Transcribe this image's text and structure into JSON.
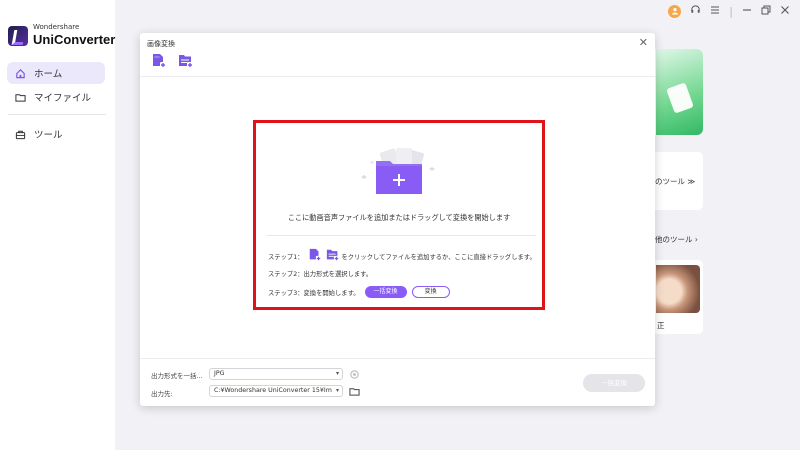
{
  "app": {
    "brand_small": "Wondershare",
    "brand_name": "UniConverter"
  },
  "sidebar": {
    "items": [
      {
        "label": "ホーム",
        "icon": "home-icon"
      },
      {
        "label": "マイファイル",
        "icon": "folder-icon"
      },
      {
        "label": "ツール",
        "icon": "toolbox-icon"
      }
    ]
  },
  "window": {
    "avatar_icon": "user-avatar-icon",
    "support_icon": "headset-icon",
    "menu_icon": "hamburger-menu-icon"
  },
  "background": {
    "tool_card_text": "のツール ≫",
    "more_tools_text": "他のツール ›",
    "photo_caption": "正"
  },
  "dialog": {
    "title": "画像変換",
    "drop_text": "ここに動画音声ファイルを追加またはドラッグして変換を開始します",
    "step1_prefix": "ステップ1：",
    "step1_suffix": "をクリックしてファイルを追加するか、ここに直接ドラッグします。",
    "step2": "ステップ2：出力形式を選択します。",
    "step3": "ステップ3：変換を開始します。",
    "convert_all_pill": "一括変換",
    "convert_pill": "変換",
    "output_format_label": "出力形式を一括...",
    "output_format_value": "JPG",
    "output_path_label": "出力先:",
    "output_path_value": "C:¥Wondershare UniConverter 15¥Im",
    "convert_all_button": "一括変換"
  },
  "colors": {
    "accent": "#8a5cf6",
    "highlight_border": "#e0131b",
    "green_thumb": "#33b865"
  }
}
